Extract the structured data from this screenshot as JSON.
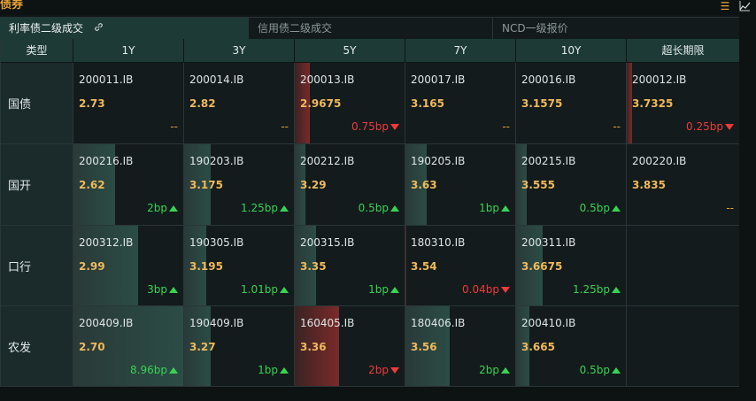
{
  "title": "债券",
  "icons": [
    "list-icon",
    "chart-icon"
  ],
  "tabs": [
    {
      "label": "利率债二级成交",
      "active": true
    },
    {
      "label": "信用债二级成交",
      "active": false
    },
    {
      "label": "NCD一级报价",
      "active": false
    }
  ],
  "columns": [
    "类型",
    "1Y",
    "3Y",
    "5Y",
    "7Y",
    "10Y",
    "超长期限"
  ],
  "rows": [
    {
      "label": "国债",
      "cells": [
        {
          "code": "200011.IB",
          "yield": "2.73",
          "change": "--",
          "dir": "flat",
          "bar": 0
        },
        {
          "code": "200014.IB",
          "yield": "2.82",
          "change": "--",
          "dir": "flat",
          "bar": 0
        },
        {
          "code": "200013.IB",
          "yield": "2.9675",
          "change": "0.75bp",
          "dir": "down",
          "bar": 0.14
        },
        {
          "code": "200017.IB",
          "yield": "3.165",
          "change": "--",
          "dir": "flat",
          "bar": 0
        },
        {
          "code": "200016.IB",
          "yield": "3.1575",
          "change": "--",
          "dir": "flat",
          "bar": 0
        },
        {
          "code": "200012.IB",
          "yield": "3.7325",
          "change": "0.25bp",
          "dir": "down",
          "bar": 0.05
        }
      ]
    },
    {
      "label": "国开",
      "cells": [
        {
          "code": "200216.IB",
          "yield": "2.62",
          "change": "2bp",
          "dir": "up",
          "bar": 0.38
        },
        {
          "code": "190203.IB",
          "yield": "3.175",
          "change": "1.25bp",
          "dir": "up",
          "bar": 0.24
        },
        {
          "code": "200212.IB",
          "yield": "3.29",
          "change": "0.5bp",
          "dir": "up",
          "bar": 0.1
        },
        {
          "code": "190205.IB",
          "yield": "3.63",
          "change": "1bp",
          "dir": "up",
          "bar": 0.19
        },
        {
          "code": "200215.IB",
          "yield": "3.555",
          "change": "0.5bp",
          "dir": "up",
          "bar": 0.1
        },
        {
          "code": "200220.IB",
          "yield": "3.835",
          "change": "--",
          "dir": "flat",
          "bar": 0
        }
      ]
    },
    {
      "label": "口行",
      "cells": [
        {
          "code": "200312.IB",
          "yield": "2.99",
          "change": "3bp",
          "dir": "up",
          "bar": 0.59
        },
        {
          "code": "190305.IB",
          "yield": "3.195",
          "change": "1.01bp",
          "dir": "up",
          "bar": 0.2
        },
        {
          "code": "200315.IB",
          "yield": "3.35",
          "change": "1bp",
          "dir": "up",
          "bar": 0.19
        },
        {
          "code": "180310.IB",
          "yield": "3.54",
          "change": "0.04bp",
          "dir": "down",
          "bar": 0.01
        },
        {
          "code": "200311.IB",
          "yield": "3.6675",
          "change": "1.25bp",
          "dir": "up",
          "bar": 0.24
        },
        {
          "code": "",
          "yield": "",
          "change": "",
          "dir": "none",
          "bar": 0
        }
      ]
    },
    {
      "label": "农发",
      "cells": [
        {
          "code": "200409.IB",
          "yield": "2.70",
          "change": "8.96bp",
          "dir": "up",
          "bar": 1.0
        },
        {
          "code": "190409.IB",
          "yield": "3.27",
          "change": "1bp",
          "dir": "up",
          "bar": 0.24
        },
        {
          "code": "160405.IB",
          "yield": "3.36",
          "change": "2bp",
          "dir": "down",
          "bar": 0.4
        },
        {
          "code": "180406.IB",
          "yield": "3.56",
          "change": "2bp",
          "dir": "up",
          "bar": 0.4
        },
        {
          "code": "200410.IB",
          "yield": "3.665",
          "change": "0.5bp",
          "dir": "up",
          "bar": 0.12
        },
        {
          "code": "",
          "yield": "",
          "change": "",
          "dir": "none",
          "bar": 0
        }
      ]
    }
  ]
}
